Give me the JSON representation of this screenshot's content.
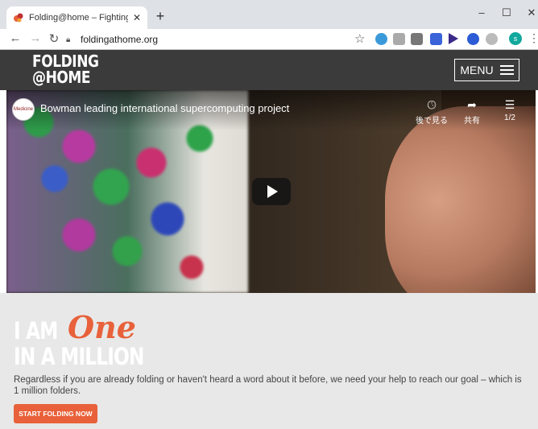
{
  "browser": {
    "tab_title": "Folding@home – Fighting diseas",
    "tab_close": "✕",
    "new_tab": "+",
    "url": "foldingathome.org",
    "minimize": "–",
    "maximize": "☐",
    "close": "✕",
    "profile_initial": "s"
  },
  "site": {
    "logo_line1": "FOLDING",
    "logo_line2": "@HOME",
    "menu_label": "MENU"
  },
  "video": {
    "channel_logo_text": "Medicine",
    "title": "Bowman leading international supercomputing project",
    "watch_later": "後で見る",
    "share": "共有",
    "playlist": "1/2"
  },
  "hero": {
    "line1_prefix": "I AM",
    "line1_script": "One",
    "line2": "IN A MILLION",
    "description": "Regardless if you are already folding or haven't heard a word about it before, we need your help to reach our goal – which is 1 million folders.",
    "cta": "START FOLDING NOW"
  },
  "colors": {
    "accent": "#e8613a",
    "header_bg": "#3b3b3b",
    "hero_bg": "#e8e8e8"
  }
}
